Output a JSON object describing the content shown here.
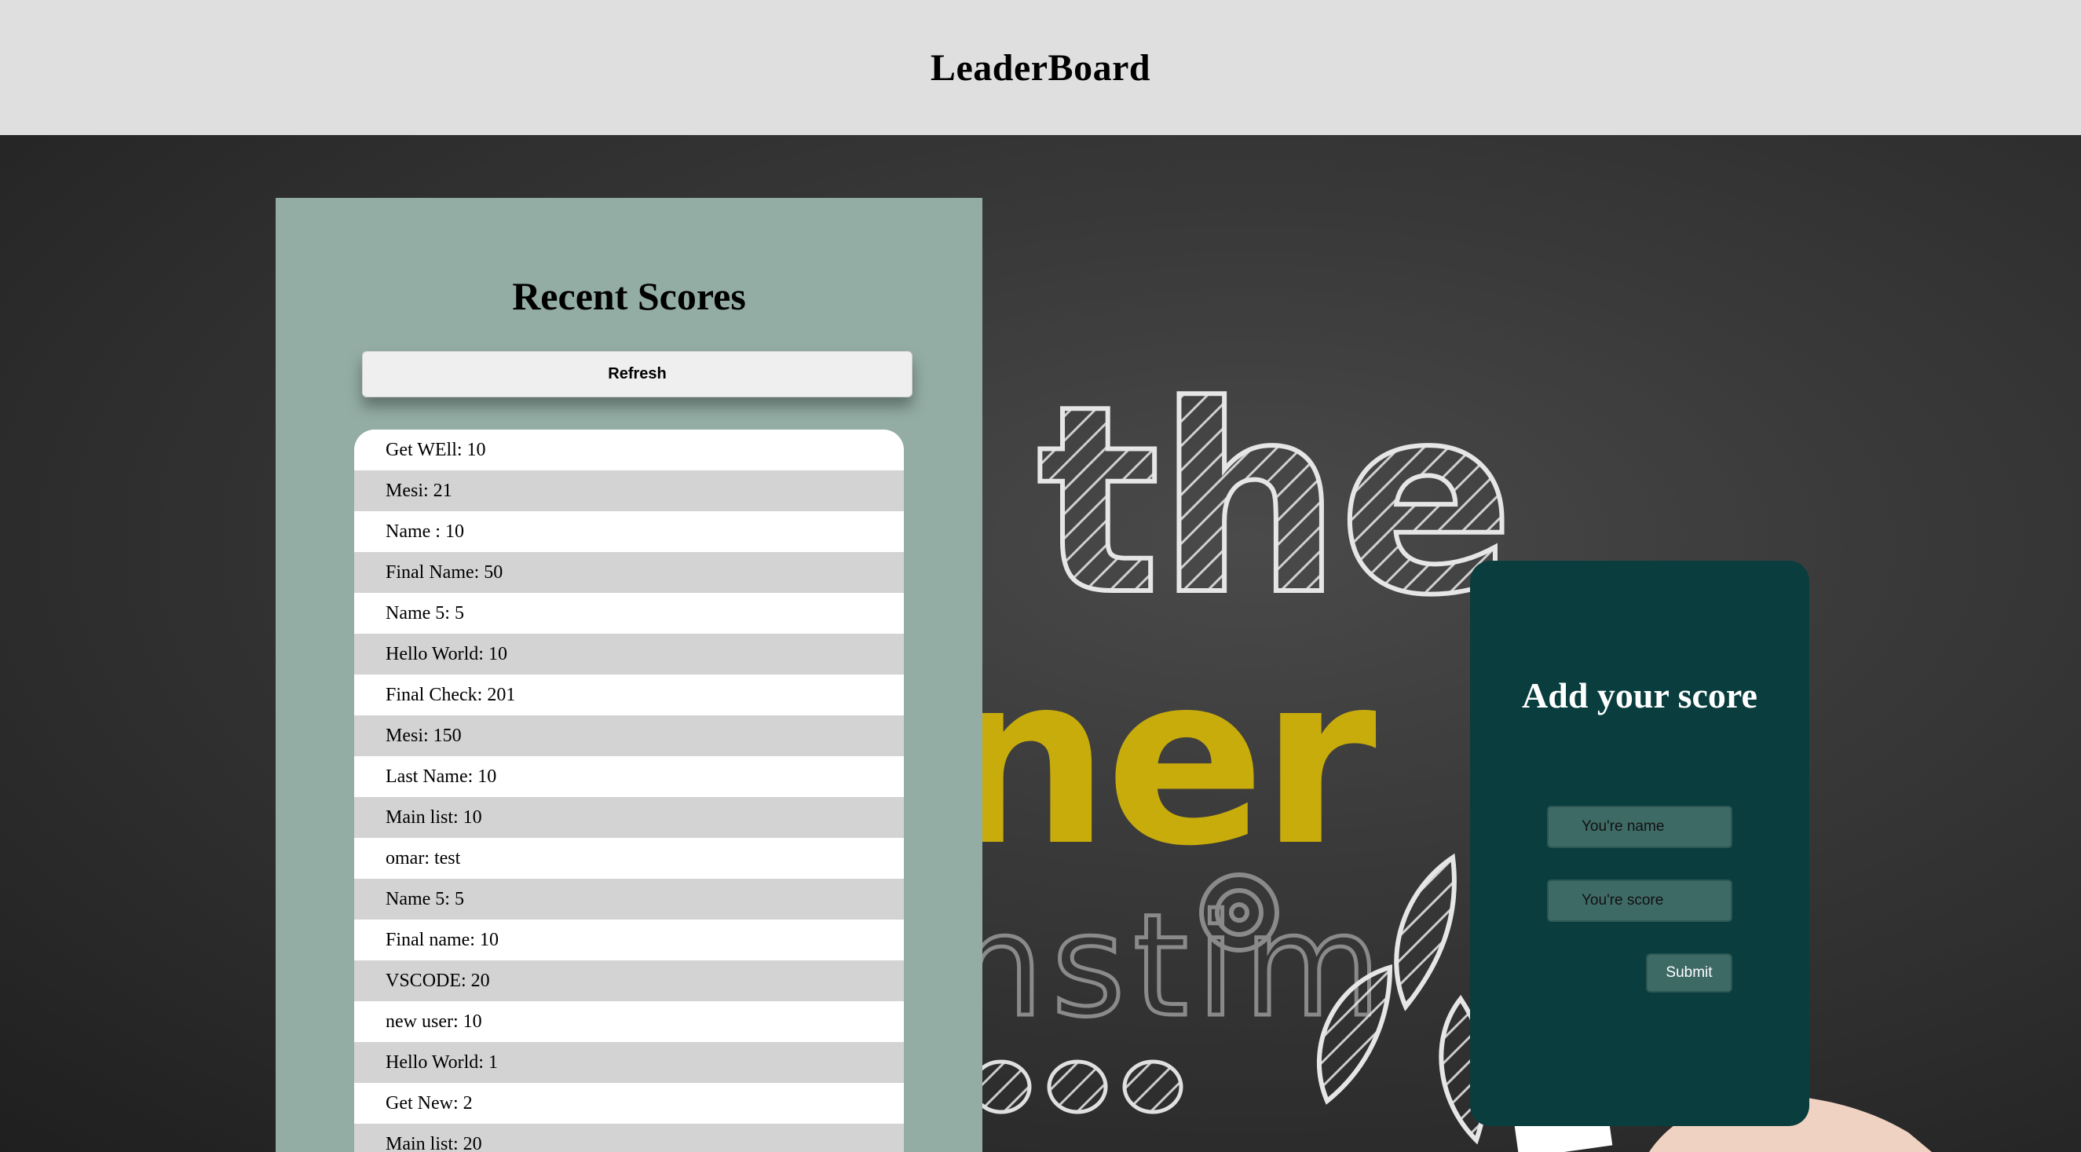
{
  "header": {
    "title": "LeaderBoard"
  },
  "recent_scores": {
    "title": "Recent Scores",
    "refresh_label": "Refresh",
    "entries": [
      "Get WEll: 10",
      "Mesi: 21",
      "Name : 10",
      "Final Name: 50",
      "Name 5: 5",
      "Hello World: 10",
      "Final Check: 201",
      "Mesi: 150",
      "Last Name: 10",
      "Main list: 10",
      "omar: test",
      "Name 5: 5",
      "Final name: 10",
      "VSCODE: 20",
      "new user: 10",
      "Hello World: 1",
      "Get New: 2",
      "Main list: 20"
    ]
  },
  "add_score": {
    "title": "Add your score",
    "name_placeholder": "You're name",
    "score_placeholder": "You're score",
    "submit_label": "Submit"
  },
  "background": {
    "chalk_word_top": "the",
    "chalk_word_middle": "ner",
    "chalk_word_lower": "nstim"
  },
  "colors": {
    "header_bg": "#dfdfdf",
    "scores_panel_bg": "#93ada4",
    "add_panel_bg": "#093d3e",
    "input_bg": "#3e6a65",
    "row_alt_bg": "#d3d3d3",
    "chalk_yellow": "#d4b608"
  }
}
